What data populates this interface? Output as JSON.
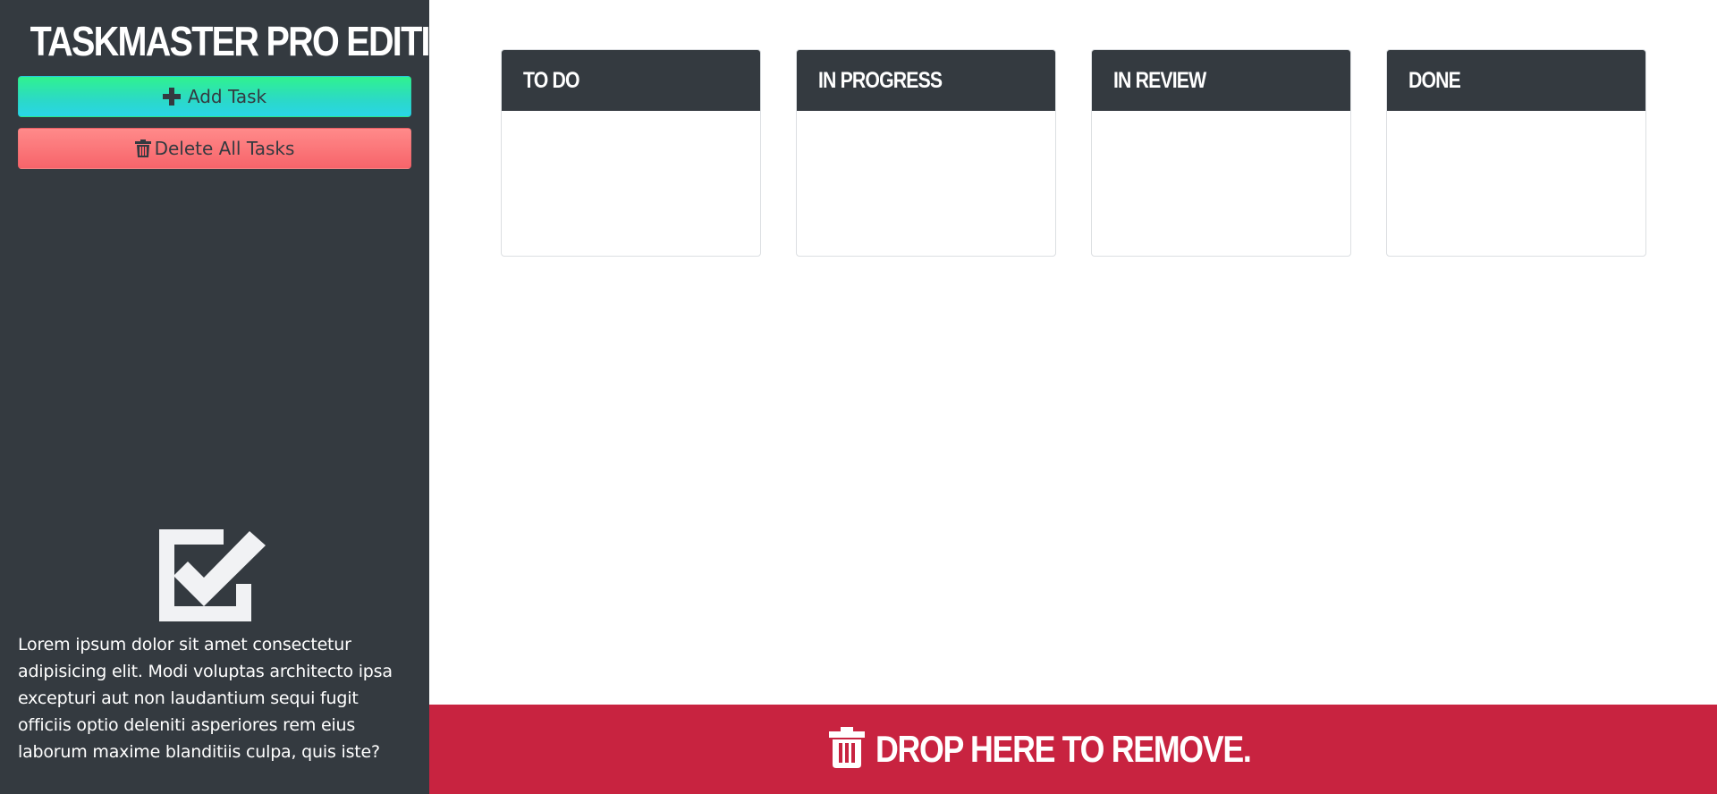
{
  "app": {
    "title": "TASKMASTER PRO EDITION"
  },
  "sidebar": {
    "add_task_label": "Add Task",
    "delete_all_label": "Delete All Tasks",
    "description": "Lorem ipsum dolor sit amet consectetur adipisicing elit. Modi voluptas architecto ipsa excepturi aut non laudantium sequi fugit officiis optio deleniti asperiores rem eius laborum maxime blanditiis culpa, quis iste?"
  },
  "icons": {
    "add": "plus-icon",
    "delete": "trash-icon",
    "logo": "checkbox-check-icon",
    "drop": "trash-icon"
  },
  "board": {
    "columns": [
      {
        "title": "TO DO",
        "tasks": []
      },
      {
        "title": "IN PROGRESS",
        "tasks": []
      },
      {
        "title": "IN REVIEW",
        "tasks": []
      },
      {
        "title": "DONE",
        "tasks": []
      }
    ]
  },
  "drop_zone": {
    "label": "DROP HERE TO REMOVE."
  },
  "colors": {
    "sidebar_bg": "#343a40",
    "column_header_bg": "#343a40",
    "add_button_gradient": [
      "#30f28f",
      "#29d5e8"
    ],
    "delete_button_gradient": [
      "#ff8a8a",
      "#f7646a"
    ],
    "drop_zone_bg": "#c82340",
    "text_light": "#ffffff"
  }
}
